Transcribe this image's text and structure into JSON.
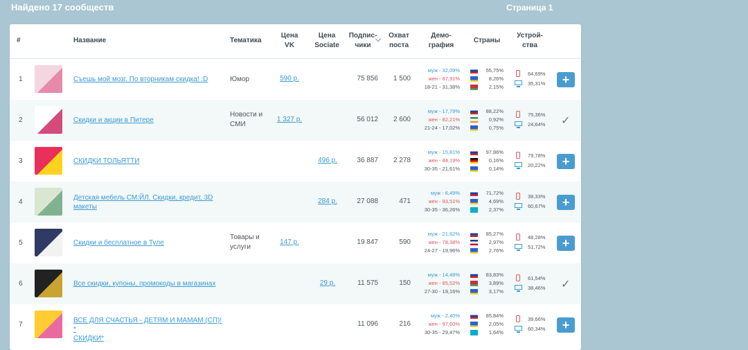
{
  "header": {
    "found": "Найдено 17 сообществ",
    "page": "Страница 1"
  },
  "columns": {
    "num": "#",
    "name": "Название",
    "topic": "Тематика",
    "price_vk": [
      "Цена",
      "VK"
    ],
    "price_sociate": [
      "Цена",
      "Sociate"
    ],
    "subscribers": [
      "Подпис-",
      "чики"
    ],
    "reach": [
      "Охват",
      "поста"
    ],
    "demo": [
      "Демо-",
      "графия"
    ],
    "countries": "Страны",
    "devices": [
      "Устрой-",
      "ства"
    ]
  },
  "rows": [
    {
      "num": "1",
      "name": [
        "Съешь мой мозг. По вторникам скидка! :D"
      ],
      "topic": [
        "Юмор"
      ],
      "price_vk": "590 р.",
      "price_sociate": "",
      "subs": "75 856",
      "reach": "1 500",
      "male": "муж - 32,09%",
      "female": "жен - 67,91%",
      "age": "18-21 - 31,38%",
      "countries": [
        "55,75%",
        "8,26%",
        "2,15%"
      ],
      "flags": [
        "ru",
        "ua",
        "by"
      ],
      "mobile": "64,69%",
      "desktop": "35,31%",
      "action": "add"
    },
    {
      "num": "2",
      "name": [
        "Скидки и акции в Питере"
      ],
      "topic": [
        "Новости и",
        "СМИ"
      ],
      "price_vk": "1 327 р.",
      "price_sociate": "",
      "subs": "56 012",
      "reach": "2 600",
      "male": "муж - 17,79%",
      "female": "жен - 82,21%",
      "age": "21-24 - 17,02%",
      "countries": [
        "88,22%",
        "0,92%",
        "0,75%"
      ],
      "flags": [
        "ru",
        "ie",
        "ua"
      ],
      "mobile": "75,36%",
      "desktop": "24,64%",
      "action": "check"
    },
    {
      "num": "3",
      "name": [
        "СКИДКИ ТОЛЬЯТТИ"
      ],
      "topic": [],
      "price_vk": "",
      "price_sociate": "496 р.",
      "subs": "36 887",
      "reach": "2 278",
      "male": "муж - 15,81%",
      "female": "жен - 84,19%",
      "age": "30-35 - 21,61%",
      "countries": [
        "97,86%",
        "0,16%",
        "0,14%"
      ],
      "flags": [
        "ru",
        "de",
        "ua"
      ],
      "mobile": "79,78%",
      "desktop": "20,22%",
      "action": "add"
    },
    {
      "num": "4",
      "name": [
        "Детская мебель СМ:ЙЛ. Скидки, кредит, 3D",
        "макеты"
      ],
      "topic": [],
      "price_vk": "",
      "price_sociate": "284 р.",
      "subs": "27 088",
      "reach": "471",
      "male": "муж - 6,49%",
      "female": "жен - 93,51%",
      "age": "30-35 - 36,26%",
      "countries": [
        "71,72%",
        "4,69%",
        "2,37%"
      ],
      "flags": [
        "ru",
        "ua",
        "kz"
      ],
      "mobile": "39,33%",
      "desktop": "60,67%",
      "action": "add"
    },
    {
      "num": "5",
      "name": [
        "Скидки и бесплатное в Туле"
      ],
      "topic": [
        "Товары и",
        "услуги"
      ],
      "price_vk": "147 р.",
      "price_sociate": "",
      "subs": "19 847",
      "reach": "590",
      "male": "муж - 21,62%",
      "female": "жен - 78,38%",
      "age": "24-27 - 19,96%",
      "countries": [
        "85,27%",
        "2,97%",
        "2,76%"
      ],
      "flags": [
        "ru",
        "gb",
        "ua"
      ],
      "mobile": "48,28%",
      "desktop": "51,72%",
      "action": "add"
    },
    {
      "num": "6",
      "name": [
        "Все скидки, купоны, промокоды в магазинах"
      ],
      "topic": [],
      "price_vk": "",
      "price_sociate": "29 р.",
      "subs": "11 575",
      "reach": "150",
      "male": "муж - 14,48%",
      "female": "жен - 85,52%",
      "age": "27-30 - 19,16%",
      "countries": [
        "83,83%",
        "3,89%",
        "3,17%"
      ],
      "flags": [
        "ru",
        "by",
        "ua"
      ],
      "mobile": "61,54%",
      "desktop": "38,46%",
      "action": "check"
    },
    {
      "num": "7",
      "name": [
        "ВСЕ ДЛЯ СЧАСТЬЯ - ДЕТЯМ И МАМАМ (СП)! *",
        "СКИДКИ*"
      ],
      "topic": [],
      "price_vk": "",
      "price_sociate": "",
      "subs": "11 096",
      "reach": "216",
      "male": "муж - 2,40%",
      "female": "жен - 97,60%",
      "age": "30-35 - 29,47%",
      "countries": [
        "85,84%",
        "2,05%",
        "1,64%"
      ],
      "flags": [
        "ru",
        "ua",
        "kz"
      ],
      "mobile": "39,66%",
      "desktop": "60,34%",
      "action": "add"
    }
  ],
  "labels": {
    "add": "+",
    "check": "✓"
  },
  "flag_colors": {
    "ru": [
      "#ffffff",
      "#1c3fa8",
      "#d52b1e"
    ],
    "ua": [
      "#2b62c9",
      "#2b62c9",
      "#f6d32d"
    ],
    "by": [
      "#c8313e",
      "#c8313e",
      "#4aa657"
    ],
    "ie": [
      "#169b62",
      "#ffffff",
      "#ff883e"
    ],
    "de": [
      "#111111",
      "#d00000",
      "#ffce00"
    ],
    "kz": [
      "#00afca",
      "#00afca",
      "#00afca"
    ],
    "gb": [
      "#1d3c8f",
      "#ffffff",
      "#c8102e"
    ]
  }
}
